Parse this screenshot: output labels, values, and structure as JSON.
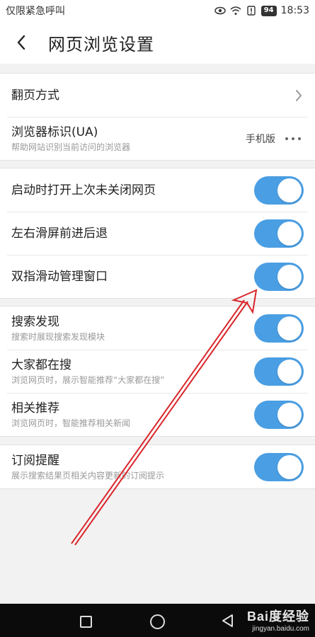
{
  "status_bar": {
    "left_text": "仅限紧急呼叫",
    "battery": "94",
    "time": "18:53"
  },
  "header": {
    "title": "网页浏览设置",
    "back_icon": "chevron-left-icon"
  },
  "sections": [
    {
      "rows": [
        {
          "title": "翻页方式",
          "control": "chevron"
        },
        {
          "title": "浏览器标识(UA)",
          "subtitle": "帮助网站识别当前访问的浏览器",
          "value": "手机版",
          "control": "more"
        }
      ]
    },
    {
      "rows": [
        {
          "title": "启动时打开上次未关闭网页",
          "control": "toggle",
          "on": true
        },
        {
          "title": "左右滑屏前进后退",
          "control": "toggle",
          "on": true
        },
        {
          "title": "双指滑动管理窗口",
          "control": "toggle",
          "on": true
        }
      ]
    },
    {
      "rows": [
        {
          "title": "搜索发现",
          "subtitle": "搜索时展现搜索发现模块",
          "control": "toggle",
          "on": true
        },
        {
          "title": "大家都在搜",
          "subtitle": "浏览网页时，展示智能推荐“大家都在搜”",
          "control": "toggle",
          "on": true
        },
        {
          "title": "相关推荐",
          "subtitle": "浏览网页时，智能推荐相关新闻",
          "control": "toggle",
          "on": true
        }
      ]
    },
    {
      "rows": [
        {
          "title": "订阅提醒",
          "subtitle": "展示搜索结果页相关内容更新的订阅提示",
          "control": "toggle",
          "on": true
        }
      ]
    }
  ],
  "watermark": {
    "main": "Bai度经验",
    "sub": "jingyan.baidu.com"
  },
  "colors": {
    "toggle_on": "#4a9ee3",
    "annotation": "#d9262b",
    "background": "#f2f2f2"
  }
}
